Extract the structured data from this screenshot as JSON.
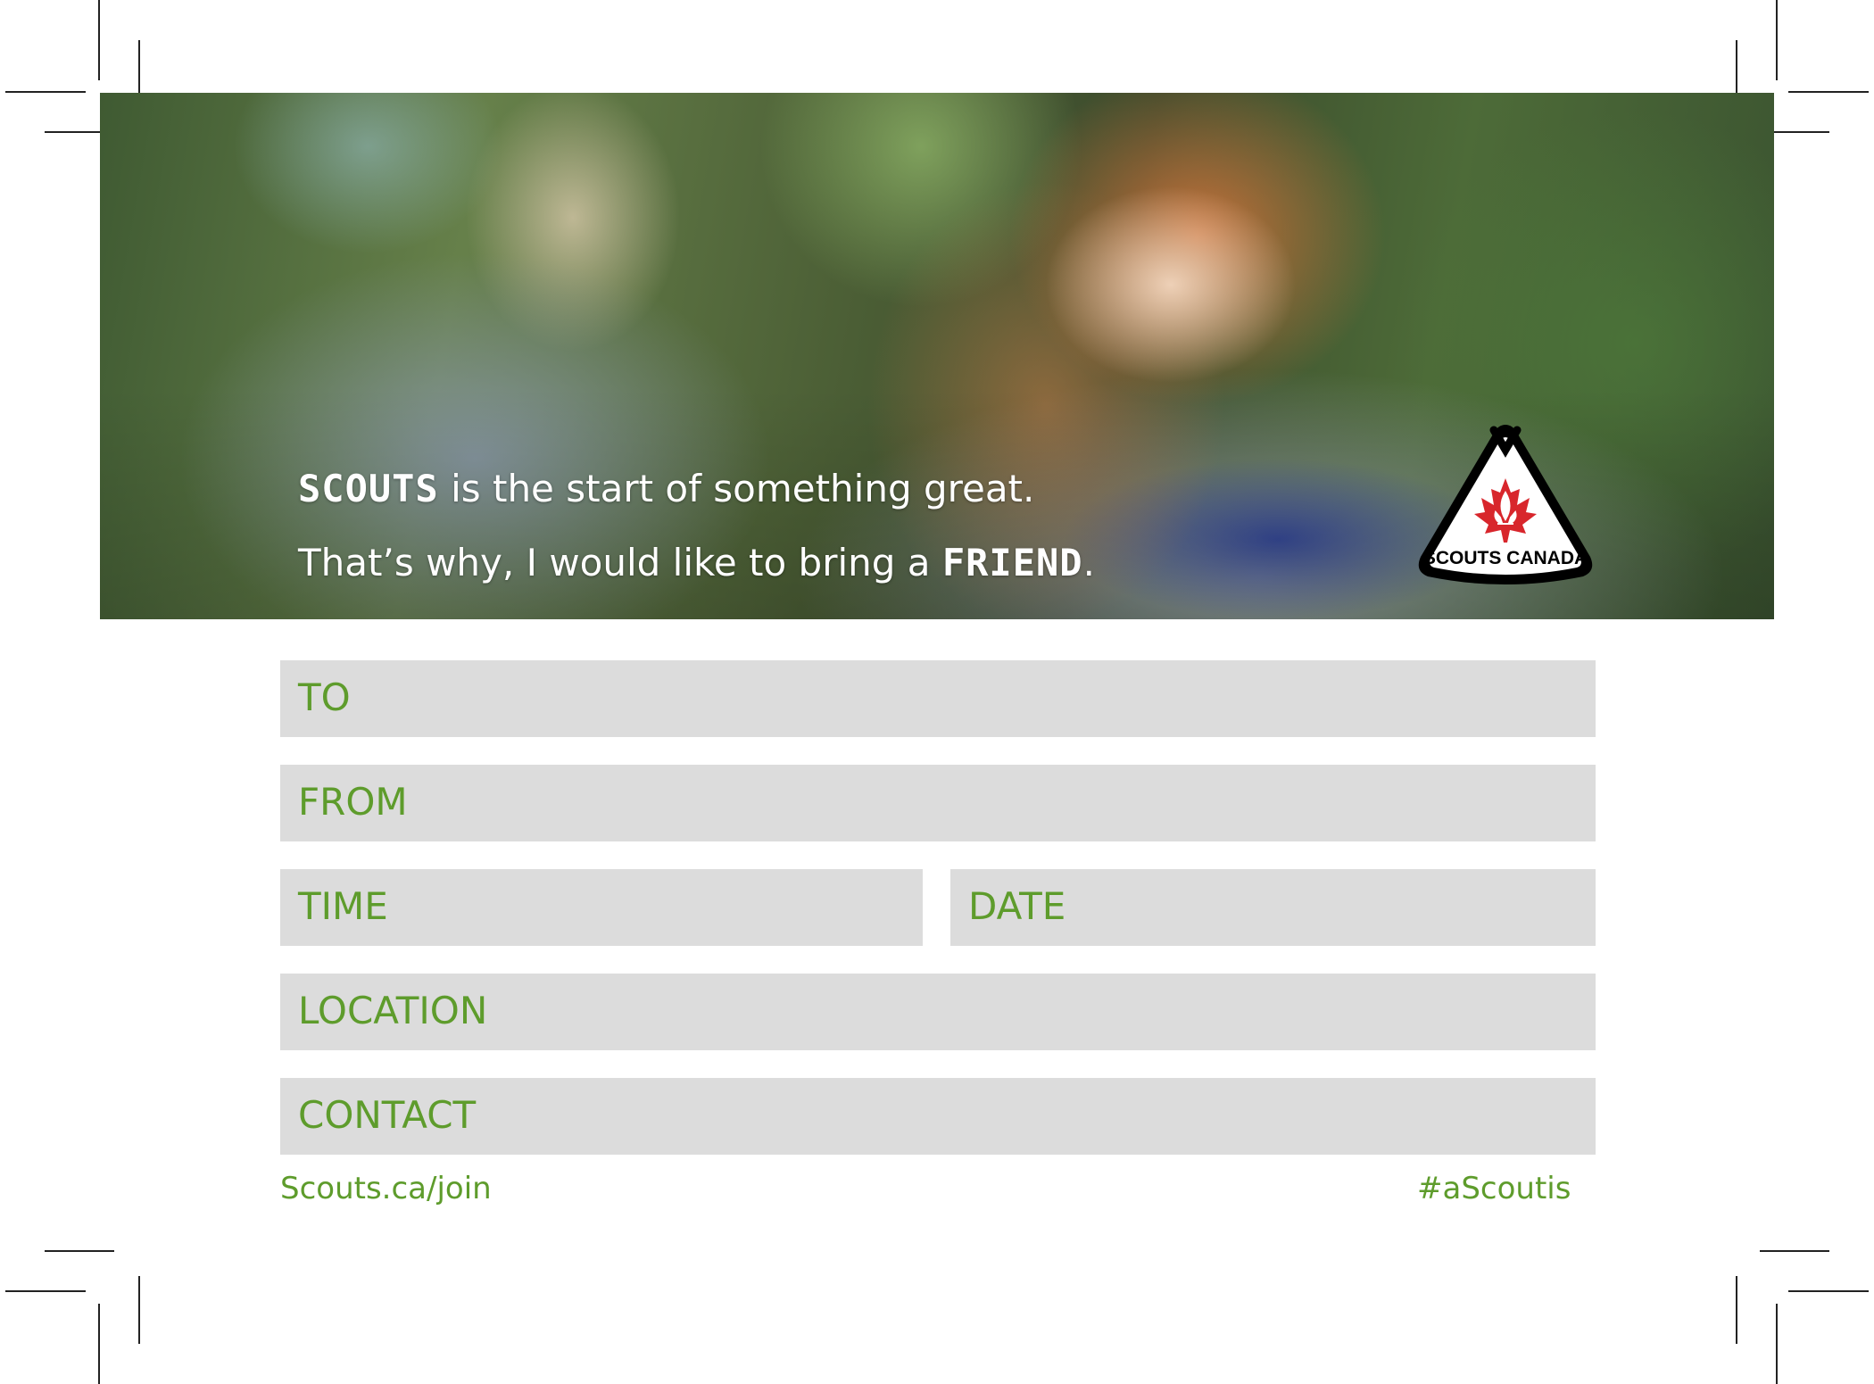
{
  "hero": {
    "line1_strong": "SCOUTS",
    "line1_rest": " is the start of something great.",
    "line2_start": "That’s why, I would like to bring a ",
    "line2_strong": "FRIEND",
    "line2_end": "."
  },
  "logo": {
    "text": "SCOUTS CANADA",
    "icon": "maple-leaf-fleur-de-lis-tent-icon",
    "leaf_color": "#d8262c"
  },
  "form": {
    "to_label": "TO",
    "from_label": "FROM",
    "time_label": "TIME",
    "date_label": "DATE",
    "location_label": "LOCATION",
    "contact_label": "CONTACT"
  },
  "footer": {
    "link": "Scouts.ca/join",
    "hashtag": "#aScoutis"
  },
  "colors": {
    "accent_green": "#5e9c2c",
    "field_gray": "#dcdcdc"
  }
}
